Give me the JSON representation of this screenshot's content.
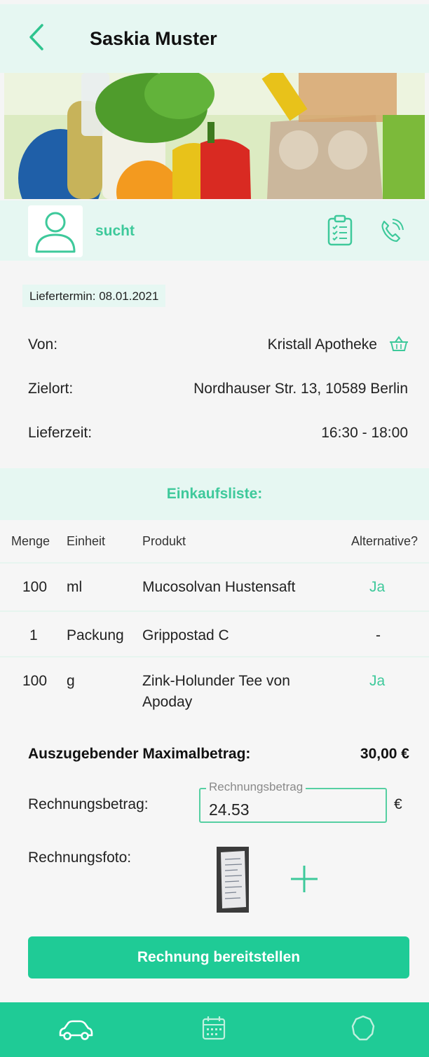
{
  "header": {
    "title": "Saskia Muster",
    "back_icon": "chevron-left-icon"
  },
  "hero": {
    "image": "groceries-photo"
  },
  "user": {
    "status": "sucht",
    "avatar_icon": "person-icon",
    "list_icon": "checklist-icon",
    "phone_icon": "phone-icon"
  },
  "delivery": {
    "date_badge": "Liefertermin: 08.01.2021",
    "from_label": "Von:",
    "from_value": "Kristall Apotheke",
    "from_icon": "basket-icon",
    "dest_label": "Zielort:",
    "dest_value": "Nordhauser Str. 13, 10589 Berlin",
    "time_label": "Lieferzeit:",
    "time_value": "16:30 - 18:00"
  },
  "shopping_list": {
    "title": "Einkaufsliste:",
    "columns": [
      "Menge",
      "Einheit",
      "Produkt",
      "Alternative?"
    ],
    "rows": [
      {
        "menge": "100",
        "einheit": "ml",
        "produkt": "Mucosolvan Hustensaft",
        "produkt2": "",
        "alternative": "Ja"
      },
      {
        "menge": "1",
        "einheit": "Packung",
        "produkt": "Grippostad C",
        "produkt2": "",
        "alternative": "-"
      },
      {
        "menge": "100",
        "einheit": "g",
        "produkt": "Zink-Holunder Tee von",
        "produkt2": "Apoday",
        "alternative": "Ja"
      }
    ]
  },
  "payment": {
    "max_label": "Auszugebender Maximalbetrag:",
    "max_value": "30,00 €",
    "amount_label": "Rechnungsbetrag:",
    "amount_legend": "Rechnungsbetrag",
    "amount_value": "24.53",
    "currency": "€",
    "photo_label": "Rechnungsfoto:",
    "add_icon": "plus-icon",
    "submit_label": "Rechnung bereitstellen"
  },
  "nav": {
    "items": [
      "car-icon",
      "calendar-icon",
      "settings-icon"
    ]
  },
  "colors": {
    "accent": "#1fcb96",
    "accent_text": "#3ec99b",
    "pale": "#e6f7f2"
  }
}
